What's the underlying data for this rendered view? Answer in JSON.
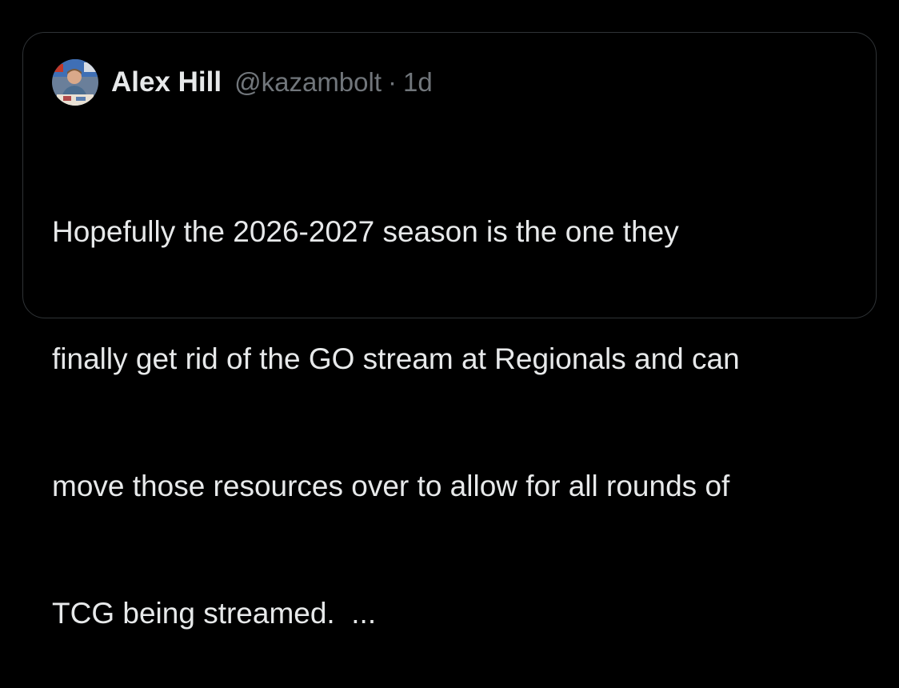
{
  "tweet": {
    "author_name": "Alex Hill",
    "handle": "@kazambolt",
    "separator": "·",
    "time": "1d",
    "lines": [
      "Hopefully the 2026-2027 season is the one they",
      "finally get rid of the GO stream at Regionals and can",
      "move those resources over to allow for all rounds of",
      "TCG being streamed.  ..."
    ]
  },
  "colors": {
    "background": "#000000",
    "border": "#2f3336",
    "primary_text": "#e7e9ea",
    "secondary_text": "#71767b"
  },
  "icons": {
    "avatar": "user-photo-avatar"
  }
}
